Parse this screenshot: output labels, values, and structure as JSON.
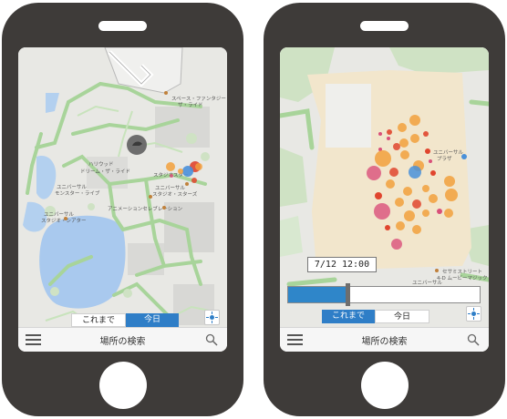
{
  "left_phone": {
    "map": {
      "labels": {
        "hollywood": "ハリウッド\nドリーム・ザ・ライド",
        "studio_stars": "スタジオスター",
        "universal_monster": "ユニバーサル\nモンスター・ライブ",
        "universal_studio": "ユニバーサル\nスタジオ・スターズ",
        "animation": "アニメーションセレブレーション",
        "lagoon": "ユニバーサル\nスタジオ・シアター",
        "top_right": "スペース・ファンタジー\nザ・ライド"
      }
    },
    "segment": {
      "past": "これまで",
      "today": "今日",
      "active": "today"
    },
    "bottom_bar": {
      "search_label": "場所の検索"
    }
  },
  "right_phone": {
    "map": {
      "labels": {
        "universal_plaza": "ユニバーサル\nプラザ",
        "universal_lower": "ユニバーサル",
        "cinema": "セサミストリート\n4-D ムービーマジック"
      }
    },
    "timeline": {
      "time_label": "7/12 12:00",
      "progress": 0.3
    },
    "segment": {
      "past": "これまで",
      "today": "今日",
      "active": "past"
    },
    "bottom_bar": {
      "search_label": "場所の検索"
    }
  },
  "colors": {
    "accent_blue": "#2f7ec7",
    "phone_body": "#3e3b39",
    "heat_orange": "#f2a03c",
    "heat_red": "#e0452e",
    "heat_pink": "#d9507a",
    "heat_blue": "#4a90d9",
    "route_green": "#a8d49a",
    "water_blue": "#a9c9ee"
  }
}
